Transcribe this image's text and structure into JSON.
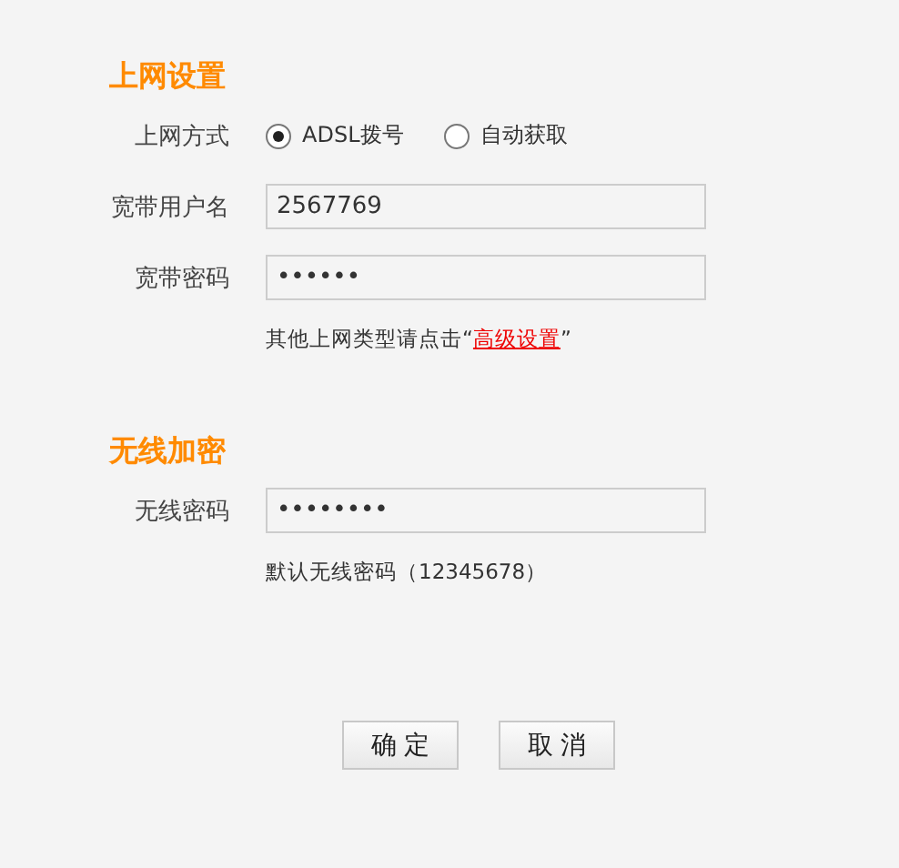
{
  "sections": [
    {
      "title": "上网设置",
      "rows": [
        {
          "kind": "radio",
          "label": "上网方式",
          "options": [
            {
              "label": "ADSL拨号",
              "selected": true
            },
            {
              "label": "自动获取",
              "selected": false
            }
          ]
        },
        {
          "kind": "field",
          "label": "宽带用户名",
          "value": "2567769"
        },
        {
          "kind": "field",
          "label": "宽带密码",
          "value": "••••••"
        },
        {
          "kind": "note",
          "prefix": "其他上网类型请点击“",
          "link": "高级设置",
          "suffix": "”"
        }
      ]
    },
    {
      "title": "无线加密",
      "rows": [
        {
          "kind": "field",
          "label": "无线密码",
          "value": "••••••••"
        },
        {
          "kind": "note",
          "prefix": "默认无线密码（12345678）"
        }
      ]
    }
  ],
  "buttons": [
    "确 定",
    "取 消"
  ]
}
